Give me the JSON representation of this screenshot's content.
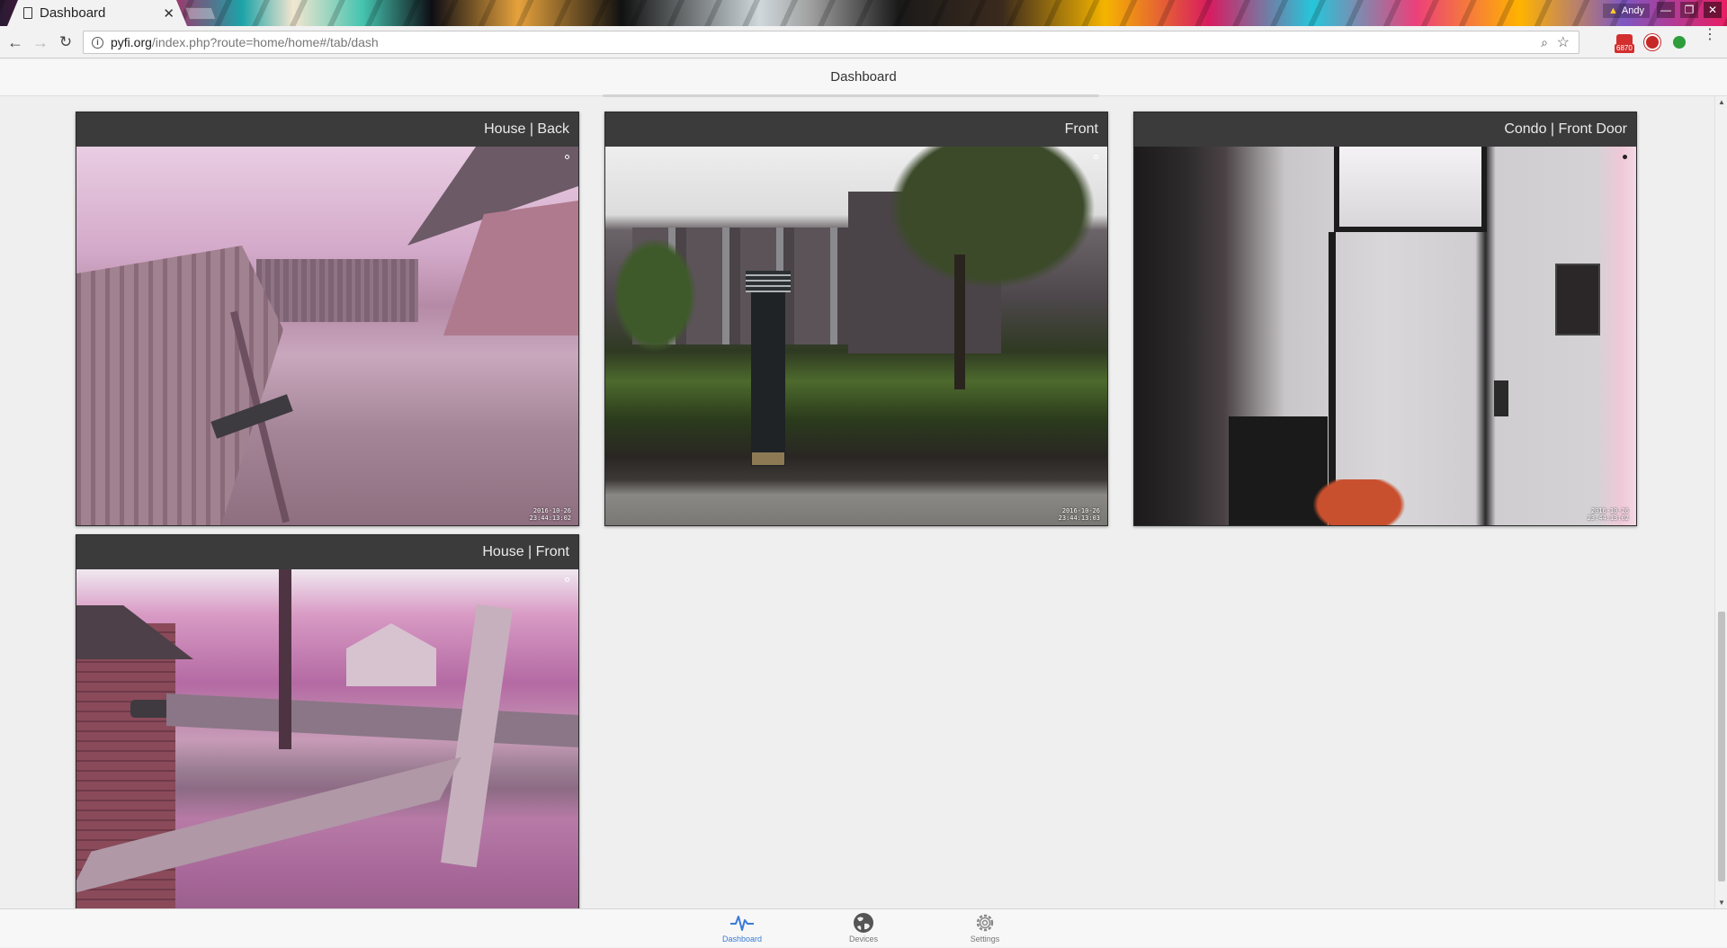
{
  "browser": {
    "tab_title": "Dashboard",
    "profile_name": "Andy",
    "url_host": "pyfi.org",
    "url_path": "/index.php?route=home/home#/tab/dash",
    "gmail_badge": "6870"
  },
  "app": {
    "page_title": "Dashboard"
  },
  "cameras": [
    {
      "title": "House | Back",
      "timestamp_date": "2016-10-26",
      "timestamp_time": "23:44:13:02"
    },
    {
      "title": "Front",
      "timestamp_date": "2016-10-26",
      "timestamp_time": "23:44:13:03"
    },
    {
      "title": "Condo | Front Door",
      "timestamp_date": "2016-10-26",
      "timestamp_time": "23:44:13:02"
    },
    {
      "title": "House | Front"
    }
  ],
  "bottom_nav": [
    {
      "label": "Dashboard",
      "icon": "pulse-icon",
      "active": true
    },
    {
      "label": "Devices",
      "icon": "globe-icon",
      "active": false
    },
    {
      "label": "Settings",
      "icon": "gear-icon",
      "active": false
    }
  ],
  "colors": {
    "accent": "#3a7bd5",
    "card_header": "#3b3b3b"
  }
}
